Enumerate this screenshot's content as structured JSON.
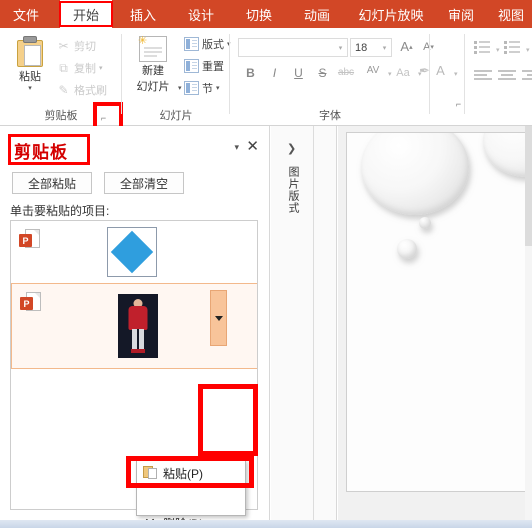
{
  "app": {
    "tabs": [
      {
        "label": "文件",
        "name": "tab-file",
        "active": false
      },
      {
        "label": "开始",
        "name": "tab-home",
        "active": true
      },
      {
        "label": "插入",
        "name": "tab-insert",
        "active": false
      },
      {
        "label": "设计",
        "name": "tab-design",
        "active": false
      },
      {
        "label": "切换",
        "name": "tab-transitions",
        "active": false
      },
      {
        "label": "动画",
        "name": "tab-animations",
        "active": false
      },
      {
        "label": "幻灯片放映",
        "name": "tab-slideshow",
        "active": false
      },
      {
        "label": "审阅",
        "name": "tab-review",
        "active": false
      },
      {
        "label": "视图",
        "name": "tab-view",
        "active": false
      }
    ],
    "accent_color": "#d24726",
    "highlight_color": "#ff0000"
  },
  "ribbon": {
    "clipboard_group": {
      "label": "剪贴板",
      "paste_label": "粘贴",
      "paste_caret": "▾",
      "cut_label": "剪切",
      "cut_icon": "scissors-icon",
      "copy_label": "复制",
      "copy_icon": "copy-icon",
      "copy_caret": "▾",
      "format_painter_label": "格式刷",
      "format_painter_icon": "brush-icon",
      "dialog_launcher": "⌐",
      "dialog_launcher_name": "clipboard-dialog-launcher"
    },
    "slides_group": {
      "label": "幻灯片",
      "new_slide_label": "新建\n幻灯片",
      "new_slide_line1": "新建",
      "new_slide_line2": "幻灯片",
      "new_slide_caret": "▾",
      "layout_label": "版式",
      "layout_caret": "▾",
      "reset_label": "重置",
      "section_label": "节",
      "section_caret": "▾"
    },
    "font_group": {
      "label": "字体",
      "font_name_value": "",
      "font_name_placeholder": "",
      "font_size_value": "18",
      "grow_font": "A",
      "shrink_font": "A",
      "bold": "B",
      "italic": "I",
      "underline": "U",
      "shadow": "S",
      "strikethrough": "abc",
      "char_spacing": "AV",
      "change_case": "Aa",
      "clear_format_icon": "eraser-icon",
      "font_color": "A",
      "dialog_launcher": "⌐"
    },
    "paragraph_group": {
      "label": "",
      "bullets_icon": "bullet-list-icon",
      "numbering_icon": "numbered-list-icon",
      "align_left_icon": "align-left-icon",
      "align_center_icon": "align-center-icon",
      "align_right_icon": "align-right-icon"
    }
  },
  "clipboard_pane": {
    "title": "剪贴板",
    "collapse_caret": "▾",
    "close_label": "✕",
    "paste_all_label": "全部粘贴",
    "clear_all_label": "全部清空",
    "hint": "单击要粘贴的项目:",
    "items": [
      {
        "name": "clipboard-item-shape",
        "icon": "powerpoint-file-icon",
        "icon_letter": "P",
        "thumbnail": "blue-diamond-shape",
        "selected": false
      },
      {
        "name": "clipboard-item-picture",
        "icon": "powerpoint-file-icon",
        "icon_letter": "P",
        "thumbnail": "photo-red-figure",
        "selected": true,
        "dropdown_caret": "▾"
      }
    ],
    "context_menu": {
      "items": [
        {
          "label": "粘贴(P)",
          "icon": "paste-icon",
          "name": "context-menu-paste",
          "highlighted": true
        },
        {
          "label": "删除(D)",
          "icon": "delete-x-icon",
          "name": "context-menu-delete",
          "highlighted": false
        }
      ]
    }
  },
  "thumbnail_strip": {
    "expand_arrow": "❯",
    "vertical_label": "图片版式"
  },
  "slide_panel": {
    "background": "water-droplets-theme",
    "droplets": 5
  }
}
